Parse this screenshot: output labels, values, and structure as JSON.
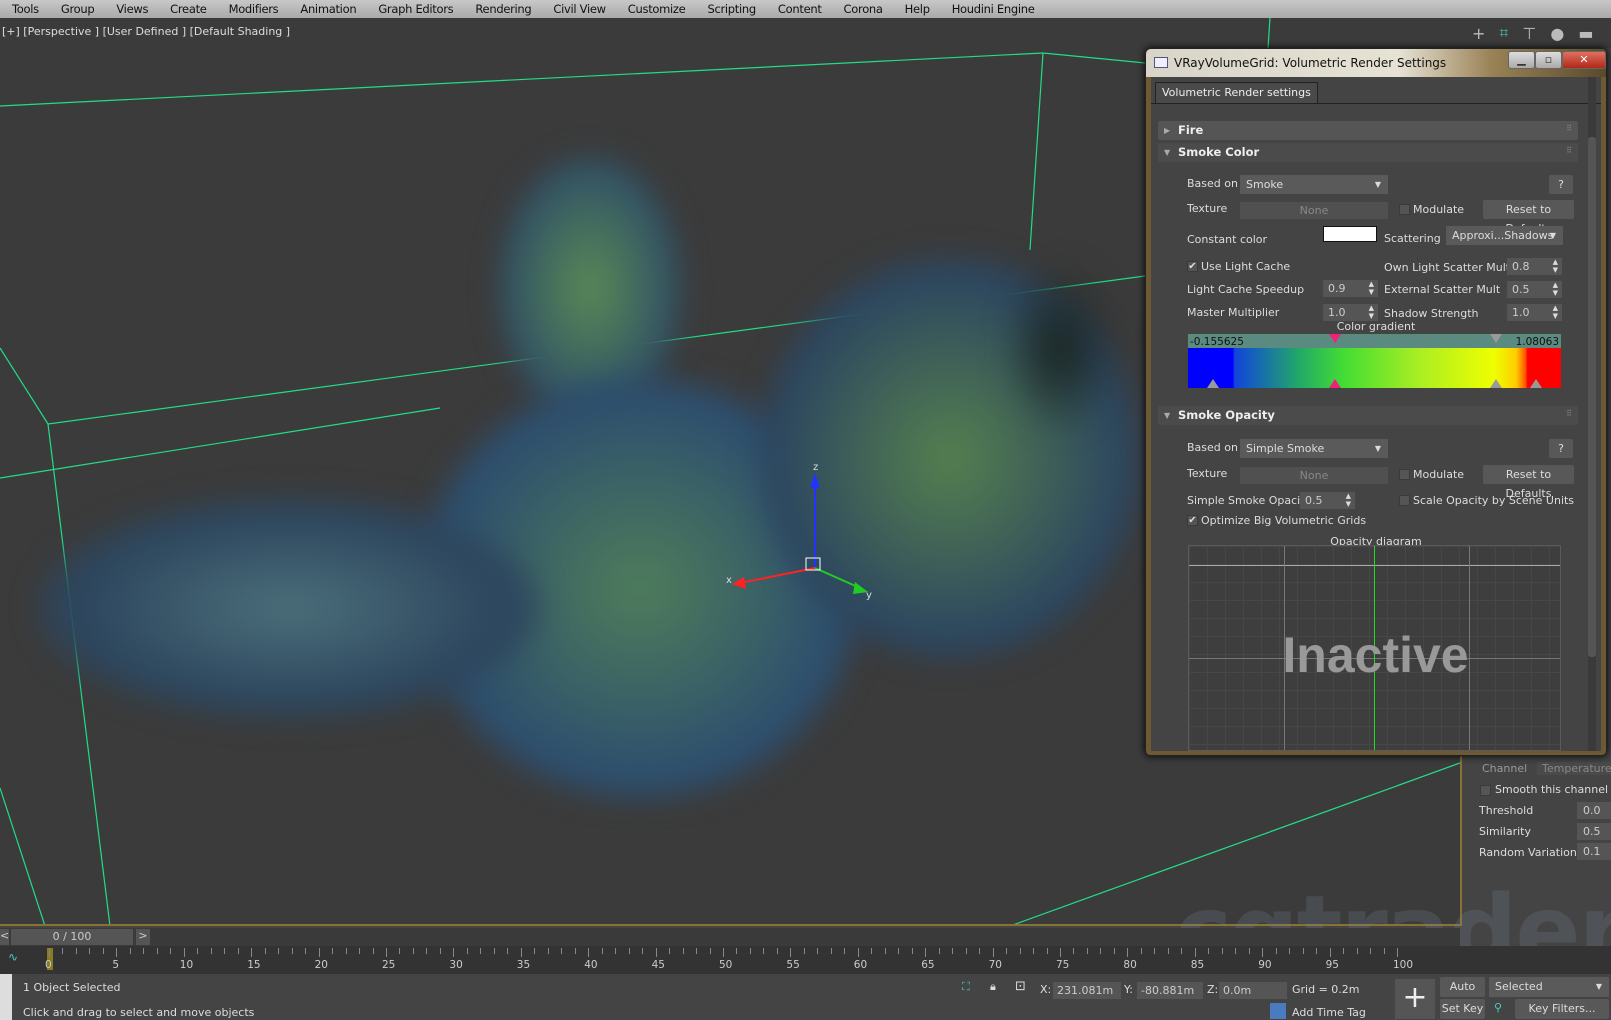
{
  "menu": [
    "Tools",
    "Group",
    "Views",
    "Create",
    "Modifiers",
    "Animation",
    "Graph Editors",
    "Rendering",
    "Civil View",
    "Customize",
    "Scripting",
    "Content",
    "Corona",
    "Help",
    "Houdini Engine"
  ],
  "viewport": {
    "label": "[+] [Perspective ] [User Defined ] [Default Shading ]",
    "gizmo_axes": [
      "x",
      "y",
      "z"
    ]
  },
  "dialog": {
    "title": "VRayVolumeGrid: Volumetric Render Settings",
    "tab": "Volumetric Render settings",
    "fire": {
      "title": "Fire"
    },
    "smoke_color": {
      "title": "Smoke Color",
      "based_on_label": "Based on",
      "based_on": "Smoke",
      "help": "?",
      "texture_label": "Texture",
      "texture": "None",
      "modulate": "Modulate",
      "modulate_checked": false,
      "reset": "Reset to Defaults",
      "constant_color_label": "Constant color",
      "constant_color": "#ffffff",
      "scattering_label": "Scattering",
      "scattering": "Approxi...Shadows",
      "use_light_cache": "Use Light Cache",
      "use_light_cache_checked": true,
      "own_scatter_label": "Own Light Scatter Mult",
      "own_scatter": "0.8",
      "lc_speedup_label": "Light Cache Speedup",
      "lc_speedup": "0.9",
      "ext_scatter_label": "External Scatter Mult",
      "ext_scatter": "0.5",
      "master_label": "Master Multiplier",
      "master": "1.0",
      "shadow_label": "Shadow Strength",
      "shadow": "1.0",
      "gradient_label": "Color gradient",
      "gradient_min": "-0.155625",
      "gradient_max": "1.08063"
    },
    "smoke_opacity": {
      "title": "Smoke Opacity",
      "based_on_label": "Based on",
      "based_on": "Simple Smoke",
      "help": "?",
      "texture_label": "Texture",
      "texture": "None",
      "modulate": "Modulate",
      "reset": "Reset to Defaults",
      "simple_opacity_label": "Simple Smoke Opacity",
      "simple_opacity": "0.5",
      "scale_opacity": "Scale Opacity by Scene Units",
      "scale_opacity_checked": false,
      "optimize": "Optimize Big Volumetric Grids",
      "optimize_checked": true,
      "diagram_label": "Opacity diagram",
      "inactive": "Inactive"
    }
  },
  "command_panel": {
    "tab_channel": "Channel",
    "tab_temperature": "Temperature",
    "smooth": "Smooth this channel",
    "threshold_label": "Threshold",
    "threshold": "0.0",
    "similarity_label": "Similarity",
    "similarity": "0.5",
    "random_label": "Random Variation",
    "random": "0.1"
  },
  "timeline": {
    "frame": "0 / 100",
    "prev": "<",
    "next": ">",
    "ticks": [
      "0",
      "5",
      "10",
      "15",
      "20",
      "25",
      "30",
      "35",
      "40",
      "45",
      "50",
      "55",
      "60",
      "65",
      "70",
      "75",
      "80",
      "85",
      "90",
      "95",
      "100"
    ]
  },
  "status": {
    "selection": "1 Object Selected",
    "prompt": "Click and drag to select and move objects",
    "x_label": "X:",
    "x": "231.081m",
    "y_label": "Y:",
    "y": "-80.881m",
    "z_label": "Z:",
    "z": "0.0m",
    "grid": "Grid = 0.2m",
    "add_time_tag": "Add Time Tag",
    "auto_key": "Auto Key",
    "selected": "Selected",
    "set_key": "Set Key",
    "key_filters": "Key Filters..."
  },
  "watermark": "cgtrader"
}
